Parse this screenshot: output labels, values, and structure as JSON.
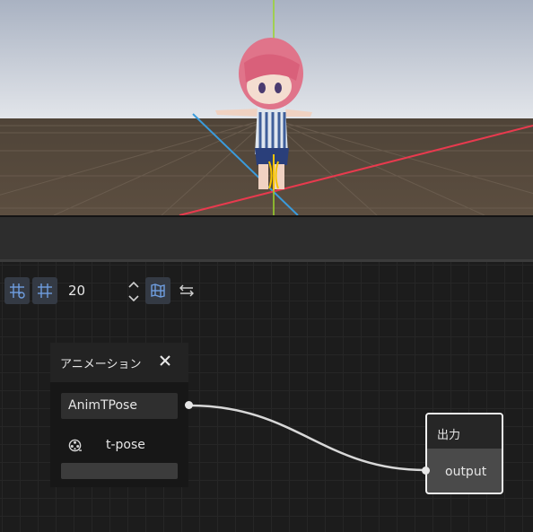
{
  "viewport": {
    "sky_top": "#aeb6c4",
    "sky_horizon": "#dfe3e8",
    "ground": "#574a3e",
    "x_axis_color": "#e83a4e",
    "y_axis_color": "#9ad62a",
    "z_axis_color": "#3a9bdc",
    "gizmo_color": "#f5c400"
  },
  "toolbar": {
    "grid_snap_icon": "grid-snap-icon",
    "grid_toggle_icon": "grid-icon",
    "grid_size": "20",
    "map_icon": "map-icon",
    "settings_icon": "sliders-icon",
    "accent": "#5b8ed6"
  },
  "animation_node": {
    "title": "アニメーション",
    "close_icon": "close-icon",
    "animation_value": "AnimTPose",
    "clip_icon": "film-reel-icon",
    "clip_name": "t-pose"
  },
  "output_node": {
    "title": "出力",
    "port_label": "output"
  }
}
